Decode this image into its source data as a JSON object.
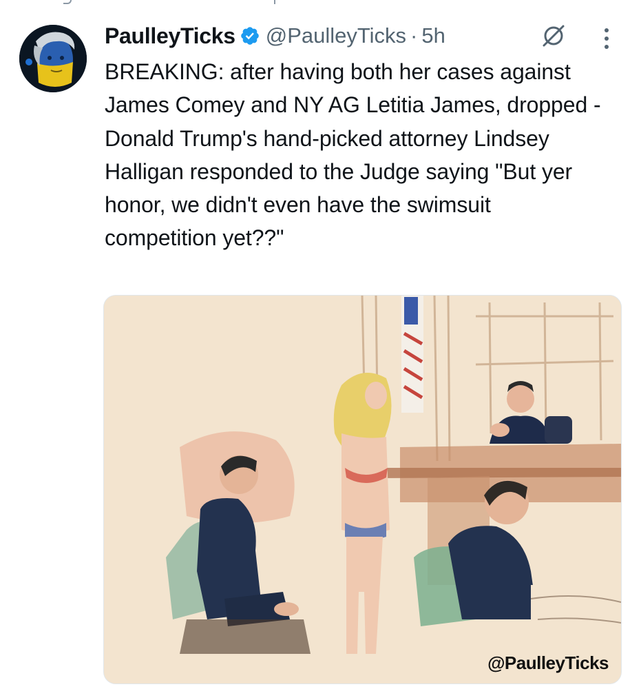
{
  "tweet": {
    "display_name": "PaulleyTicks",
    "handle": "@PaulleyTicks",
    "separator": "·",
    "time": "5h",
    "text": "BREAKING: after having both her cases against James Comey and NY AG Letitia James, dropped - Donald Trump's hand-picked attorney Lindsey Halligan responded to the Judge saying \"But yer honor, we didn't even have the swimsuit competition yet??\""
  },
  "icons": {
    "verified": "verified-badge-icon",
    "grok": "grok-icon",
    "more": "more-options-icon"
  },
  "media": {
    "watermark": "@PaulleyTicks"
  },
  "colors": {
    "text": "#0f1419",
    "secondary": "#536471",
    "verified": "#1d9bf0"
  }
}
